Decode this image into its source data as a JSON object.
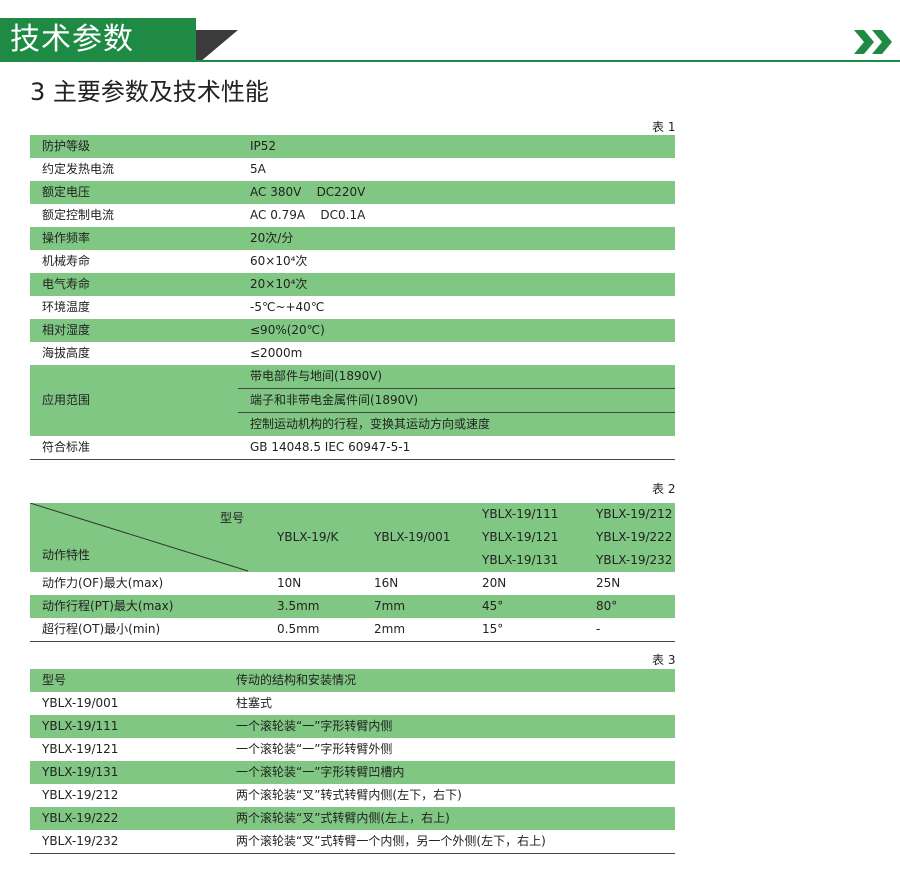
{
  "header": {
    "title": "技术参数"
  },
  "section_title": "3 主要参数及技术性能",
  "table1": {
    "caption": "表 1",
    "rows": [
      {
        "label": "防护等级",
        "value": "IP52"
      },
      {
        "label": "约定发热电流",
        "value": "5A"
      },
      {
        "label": "额定电压",
        "value": "AC 380V    DC220V"
      },
      {
        "label": "额定控制电流",
        "value": "AC 0.79A    DC0.1A"
      },
      {
        "label": "操作频率",
        "value": "20次/分"
      },
      {
        "label": "机械寿命",
        "value": "60×10⁴次"
      },
      {
        "label": "电气寿命",
        "value": "20×10⁴次"
      },
      {
        "label": "环境温度",
        "value": "-5℃~+40℃"
      },
      {
        "label": "相对湿度",
        "value": "≤90%(20℃)"
      },
      {
        "label": "海拔高度",
        "value": "≤2000m"
      }
    ],
    "application": {
      "label": "应用范围",
      "values": [
        "带电部件与地间(1890V)",
        "端子和非带电金属件间(1890V)",
        "控制运动机构的行程，变换其运动方向或速度"
      ]
    },
    "standard": {
      "label": "符合标准",
      "value": "GB 14048.5  IEC 60947-5-1"
    }
  },
  "table2": {
    "caption": "表 2",
    "header_model": "型号",
    "header_char": "动作特性",
    "models": [
      [
        "YBLX-19/K"
      ],
      [
        "YBLX-19/001"
      ],
      [
        "YBLX-19/111",
        "YBLX-19/121",
        "YBLX-19/131"
      ],
      [
        "YBLX-19/212",
        "YBLX-19/222",
        "YBLX-19/232"
      ]
    ],
    "rows": [
      {
        "label": "动作力(OF)最大(max)",
        "values": [
          "10N",
          "16N",
          "20N",
          "25N"
        ]
      },
      {
        "label": "动作行程(PT)最大(max)",
        "values": [
          "3.5mm",
          "7mm",
          "45°",
          "80°"
        ]
      },
      {
        "label": "超行程(OT)最小(min)",
        "values": [
          "0.5mm",
          "2mm",
          "15°",
          "-"
        ]
      }
    ]
  },
  "table3": {
    "caption": "表 3",
    "header": {
      "model": "型号",
      "desc": "传动的结构和安装情况"
    },
    "rows": [
      {
        "model": "YBLX-19/001",
        "desc": "柱塞式"
      },
      {
        "model": "YBLX-19/111",
        "desc": "一个滚轮装“一”字形转臂内侧"
      },
      {
        "model": "YBLX-19/121",
        "desc": "一个滚轮装“一”字形转臂外侧"
      },
      {
        "model": "YBLX-19/131",
        "desc": "一个滚轮装“一”字形转臂凹槽内"
      },
      {
        "model": "YBLX-19/212",
        "desc": "两个滚轮装“叉”转式转臂内侧(左下，右下)"
      },
      {
        "model": "YBLX-19/222",
        "desc": "两个滚轮装“叉”式转臂内侧(左上，右上)"
      },
      {
        "model": "YBLX-19/232",
        "desc": "两个滚轮装“叉”式转臂一个内侧，另一个外侧(左下，右上)"
      }
    ]
  },
  "colors": {
    "brand_green": "#1f8a43",
    "row_green": "#80c783"
  },
  "icons": [
    "double-chevron-right-icon"
  ]
}
